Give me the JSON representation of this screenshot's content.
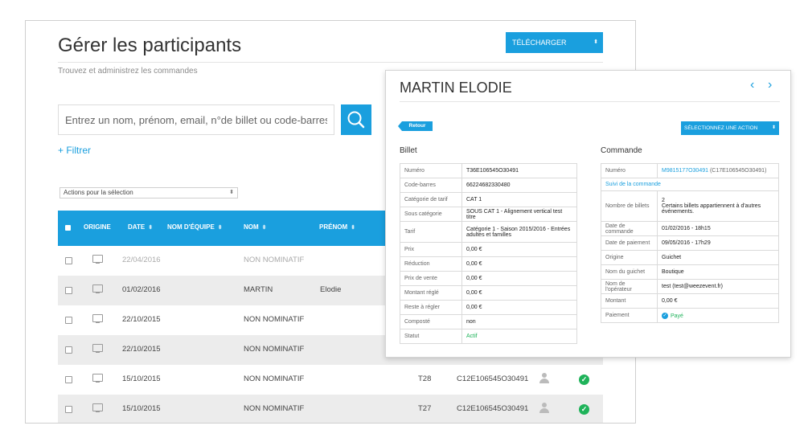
{
  "page": {
    "title": "Gérer les participants",
    "subtitle": "Trouvez et administrez les commandes",
    "download_label": "TÉLÉCHARGER",
    "search_placeholder": "Entrez un nom, prénom, email, n°de billet ou code-barres",
    "filter_link": "+ Filtrer",
    "actions_select": "Actions pour la sélection"
  },
  "table": {
    "headers": [
      "ORIGINE",
      "DATE",
      "NOM D'ÉQUIPE",
      "NOM",
      "PRÉNOM"
    ],
    "rows": [
      {
        "date": "22/04/2016",
        "nom": "NON NOMINATIF",
        "prenom": "",
        "equipe": "",
        "code": "",
        "dim": true
      },
      {
        "date": "01/02/2016",
        "nom": "MARTIN",
        "prenom": "Elodie",
        "equipe": "",
        "code": ""
      },
      {
        "date": "22/10/2015",
        "nom": "NON NOMINATIF",
        "prenom": "",
        "equipe": "",
        "code": ""
      },
      {
        "date": "22/10/2015",
        "nom": "NON NOMINATIF",
        "prenom": "",
        "equipe": "",
        "code": ""
      },
      {
        "date": "15/10/2015",
        "nom": "NON NOMINATIF",
        "prenom": "",
        "equipe": "T28",
        "code": "C12E106545O30491"
      },
      {
        "date": "15/10/2015",
        "nom": "NON NOMINATIF",
        "prenom": "",
        "equipe": "T27",
        "code": "C12E106545O30491"
      }
    ]
  },
  "detail": {
    "name": "MARTIN ELODIE",
    "nav_prev": "‹",
    "nav_next": "›",
    "back_label": "Retour",
    "action_label": "SÉLECTIONNEZ UNE ACTION",
    "billet": {
      "heading": "Billet",
      "rows": [
        {
          "k": "Numéro",
          "v": "T36E106545O30491"
        },
        {
          "k": "Code-barres",
          "v": "66224682330480"
        },
        {
          "k": "Catégorie de tarif",
          "v": "CAT 1"
        },
        {
          "k": "Sous catégorie",
          "v": "SOUS CAT 1 - Alignement vertical test titre"
        },
        {
          "k": "Tarif",
          "v": "Catégorie 1 - Saison 2015/2016 - Entrées adultes et familles"
        },
        {
          "k": "Prix",
          "v": "0,00 €"
        },
        {
          "k": "Réduction",
          "v": "0,00 €"
        },
        {
          "k": "Prix de vente",
          "v": "0,00 €"
        },
        {
          "k": "Montant réglé",
          "v": "0,00 €"
        },
        {
          "k": "Reste à régler",
          "v": "0,00 €"
        },
        {
          "k": "Composté",
          "v": "non"
        },
        {
          "k": "Statut",
          "v": "Actif"
        }
      ]
    },
    "commande": {
      "heading": "Commande",
      "numero_label": "Numéro",
      "numero_link": "M9815177O30491",
      "numero_extra": "(C17E106545O30491)",
      "suivi_link": "Suivi de la commande",
      "nb_label": "Nombre de billets",
      "nb_value": "2",
      "nb_note": "Certains billets appartiennent à d'autres événements.",
      "rows": [
        {
          "k": "Date de commande",
          "v": "01/02/2016 - 18h15"
        },
        {
          "k": "Date de paiement",
          "v": "09/05/2016 - 17h29"
        },
        {
          "k": "Origine",
          "v": "Guichet"
        },
        {
          "k": "Nom du guichet",
          "v": "Boutique"
        },
        {
          "k": "Nom de l'opérateur",
          "v": "test (test@weezevent.fr)"
        },
        {
          "k": "Montant",
          "v": "0,00 €"
        }
      ],
      "paiement_label": "Paiement",
      "paiement_value": "Payé"
    }
  },
  "colors": {
    "accent": "#1a9fde",
    "success": "#1fb35a",
    "row_alt": "#ececec"
  }
}
